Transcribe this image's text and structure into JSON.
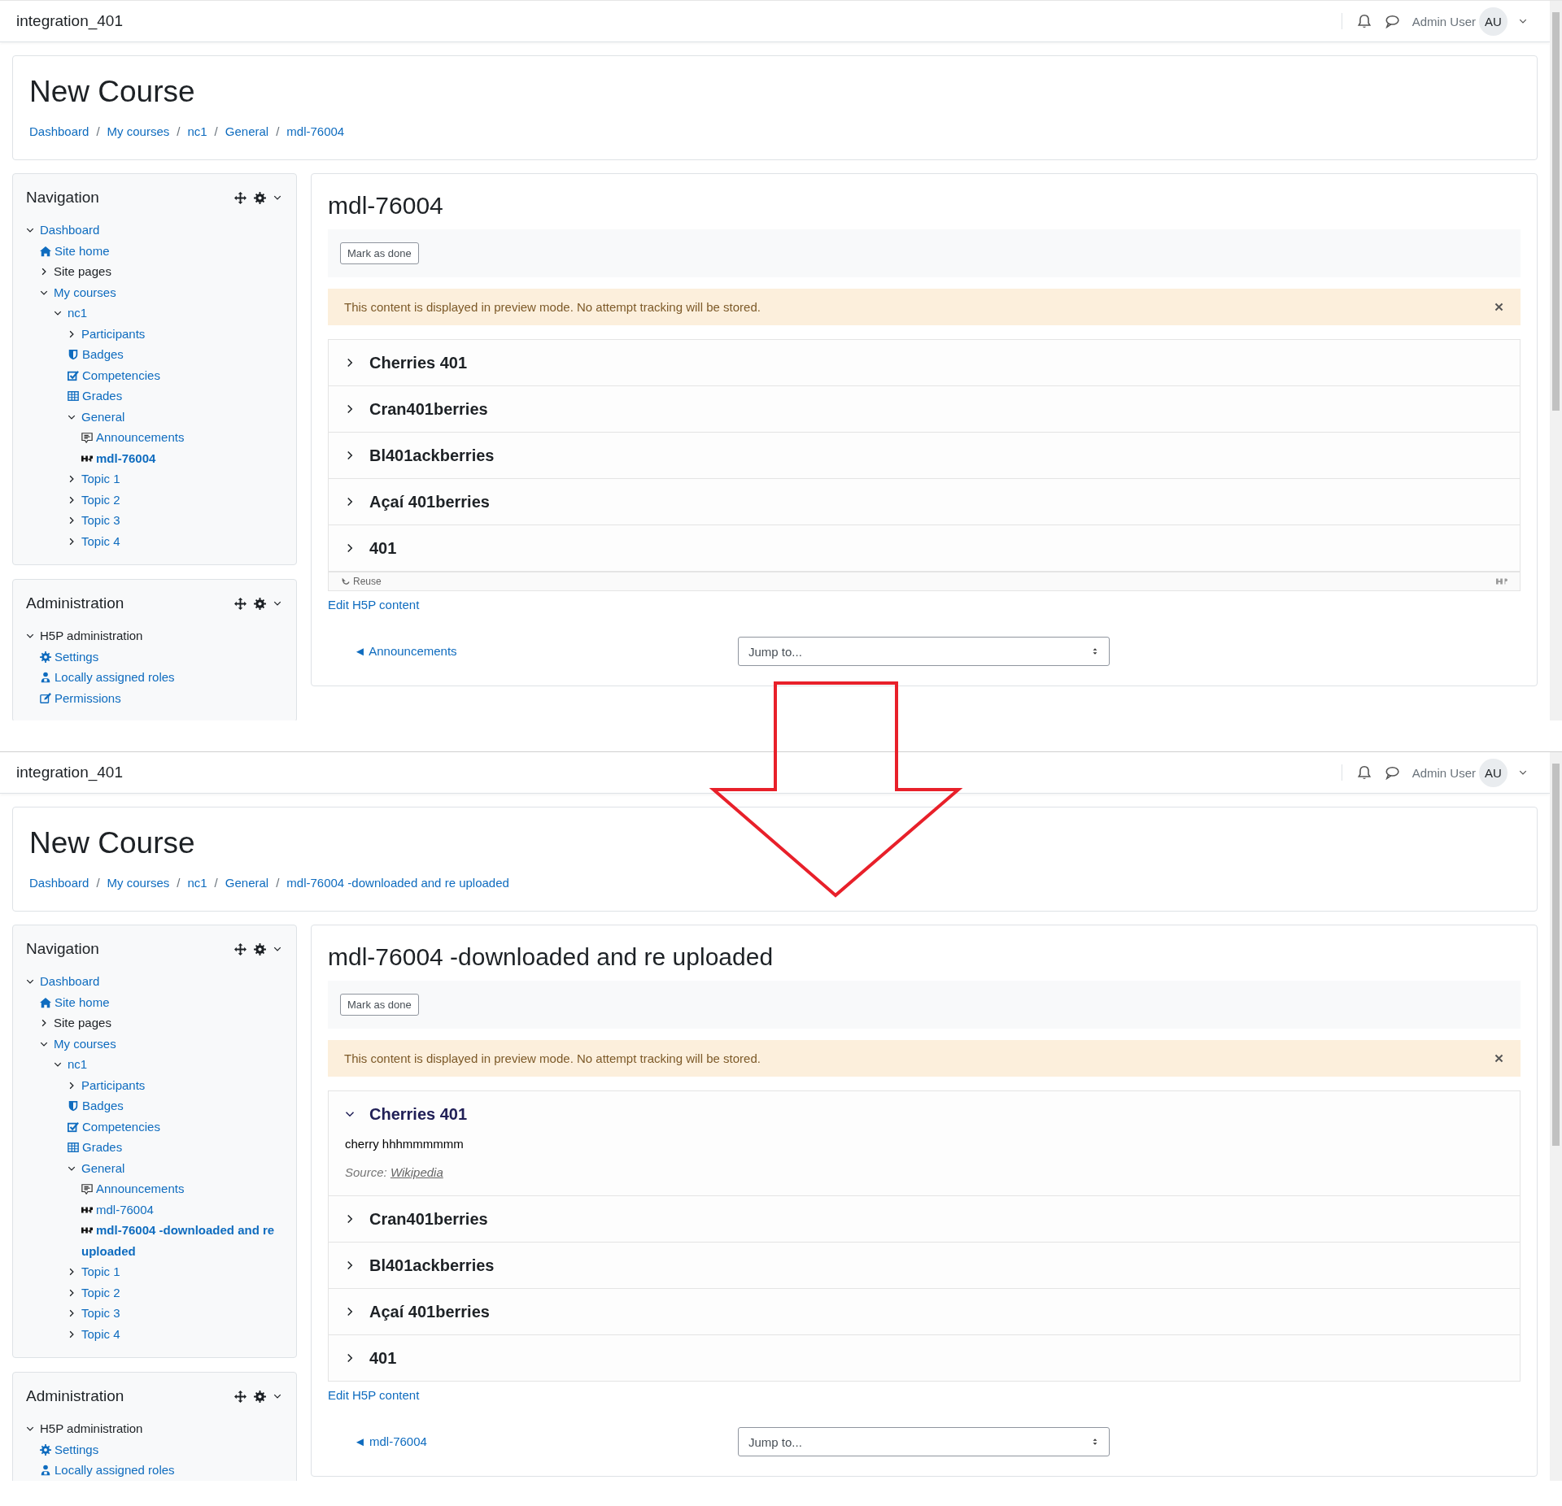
{
  "screens": [
    {
      "navbar": {
        "site_name": "integration_401",
        "user_name": "Admin User",
        "avatar": "AU"
      },
      "header": {
        "title": "New Course",
        "separator": "/",
        "breadcrumb": [
          "Dashboard",
          "My courses",
          "nc1",
          "General",
          "mdl-76004"
        ]
      },
      "blocks": [
        {
          "title": "Navigation",
          "tree": [
            {
              "label": "Dashboard",
              "kind": "branch",
              "link": true,
              "selected": false,
              "expanded": true,
              "children": [
                {
                  "label": "Site home",
                  "kind": "home",
                  "link": true,
                  "selected": false
                },
                {
                  "label": "Site pages",
                  "kind": "branch",
                  "link": false,
                  "selected": false,
                  "expanded": false
                },
                {
                  "label": "My courses",
                  "kind": "branch",
                  "link": true,
                  "selected": false,
                  "expanded": true,
                  "children": [
                    {
                      "label": "nc1",
                      "kind": "branch",
                      "link": true,
                      "selected": false,
                      "expanded": true,
                      "children": [
                        {
                          "label": "Participants",
                          "kind": "branch",
                          "link": true,
                          "selected": false,
                          "expanded": false
                        },
                        {
                          "label": "Badges",
                          "kind": "badge",
                          "link": true,
                          "selected": false
                        },
                        {
                          "label": "Competencies",
                          "kind": "competency",
                          "link": true,
                          "selected": false
                        },
                        {
                          "label": "Grades",
                          "kind": "grades",
                          "link": true,
                          "selected": false
                        },
                        {
                          "label": "General",
                          "kind": "branch",
                          "link": true,
                          "selected": false,
                          "expanded": true,
                          "children": [
                            {
                              "label": "Announcements",
                              "kind": "forum",
                              "link": true,
                              "selected": false
                            },
                            {
                              "label": "mdl-76004",
                              "kind": "h5p",
                              "link": true,
                              "selected": true
                            }
                          ]
                        },
                        {
                          "label": "Topic 1",
                          "kind": "branch",
                          "link": true,
                          "selected": false,
                          "expanded": false
                        },
                        {
                          "label": "Topic 2",
                          "kind": "branch",
                          "link": true,
                          "selected": false,
                          "expanded": false
                        },
                        {
                          "label": "Topic 3",
                          "kind": "branch",
                          "link": true,
                          "selected": false,
                          "expanded": false
                        },
                        {
                          "label": "Topic 4",
                          "kind": "branch",
                          "link": true,
                          "selected": false,
                          "expanded": false
                        }
                      ]
                    }
                  ]
                }
              ]
            }
          ]
        },
        {
          "title": "Administration",
          "tree": [
            {
              "label": "H5P administration",
              "kind": "branch",
              "link": false,
              "selected": false,
              "expanded": true,
              "children": [
                {
                  "label": "Settings",
                  "kind": "settings",
                  "link": true,
                  "selected": false
                },
                {
                  "label": "Locally assigned roles",
                  "kind": "roles",
                  "link": true,
                  "selected": false
                },
                {
                  "label": "Permissions",
                  "kind": "permissions",
                  "link": true,
                  "selected": false
                }
              ]
            }
          ]
        }
      ],
      "main": {
        "title": "mdl-76004",
        "mark_done": "Mark as done",
        "alert": "This content is displayed in preview mode. No attempt tracking will be stored.",
        "accordion": [
          {
            "title": "Cherries 401",
            "expanded": false
          },
          {
            "title": "Cran401berries",
            "expanded": false
          },
          {
            "title": "Bl401ackberries",
            "expanded": false
          },
          {
            "title": "Açaí 401berries",
            "expanded": false
          },
          {
            "title": "401",
            "expanded": false
          }
        ],
        "footer": {
          "reuse": "Reuse"
        },
        "edit_link": "Edit H5P content",
        "prev_link": "◄ Announcements",
        "jump": "Jump to..."
      }
    },
    {
      "navbar": {
        "site_name": "integration_401",
        "user_name": "Admin User",
        "avatar": "AU"
      },
      "header": {
        "title": "New Course",
        "separator": "/",
        "breadcrumb": [
          "Dashboard",
          "My courses",
          "nc1",
          "General",
          "mdl-76004 -downloaded and re uploaded"
        ]
      },
      "blocks": [
        {
          "title": "Navigation",
          "tree": [
            {
              "label": "Dashboard",
              "kind": "branch",
              "link": true,
              "selected": false,
              "expanded": true,
              "children": [
                {
                  "label": "Site home",
                  "kind": "home",
                  "link": true,
                  "selected": false
                },
                {
                  "label": "Site pages",
                  "kind": "branch",
                  "link": false,
                  "selected": false,
                  "expanded": false
                },
                {
                  "label": "My courses",
                  "kind": "branch",
                  "link": true,
                  "selected": false,
                  "expanded": true,
                  "children": [
                    {
                      "label": "nc1",
                      "kind": "branch",
                      "link": true,
                      "selected": false,
                      "expanded": true,
                      "children": [
                        {
                          "label": "Participants",
                          "kind": "branch",
                          "link": true,
                          "selected": false,
                          "expanded": false
                        },
                        {
                          "label": "Badges",
                          "kind": "badge",
                          "link": true,
                          "selected": false
                        },
                        {
                          "label": "Competencies",
                          "kind": "competency",
                          "link": true,
                          "selected": false
                        },
                        {
                          "label": "Grades",
                          "kind": "grades",
                          "link": true,
                          "selected": false
                        },
                        {
                          "label": "General",
                          "kind": "branch",
                          "link": true,
                          "selected": false,
                          "expanded": true,
                          "children": [
                            {
                              "label": "Announcements",
                              "kind": "forum",
                              "link": true,
                              "selected": false
                            },
                            {
                              "label": "mdl-76004",
                              "kind": "h5p",
                              "link": true,
                              "selected": false
                            },
                            {
                              "label": "mdl-76004 -downloaded and re uploaded",
                              "kind": "h5p",
                              "link": true,
                              "selected": true
                            }
                          ]
                        },
                        {
                          "label": "Topic 1",
                          "kind": "branch",
                          "link": true,
                          "selected": false,
                          "expanded": false
                        },
                        {
                          "label": "Topic 2",
                          "kind": "branch",
                          "link": true,
                          "selected": false,
                          "expanded": false
                        },
                        {
                          "label": "Topic 3",
                          "kind": "branch",
                          "link": true,
                          "selected": false,
                          "expanded": false
                        },
                        {
                          "label": "Topic 4",
                          "kind": "branch",
                          "link": true,
                          "selected": false,
                          "expanded": false
                        }
                      ]
                    }
                  ]
                }
              ]
            }
          ]
        },
        {
          "title": "Administration",
          "tree": [
            {
              "label": "H5P administration",
              "kind": "branch",
              "link": false,
              "selected": false,
              "expanded": true,
              "children": [
                {
                  "label": "Settings",
                  "kind": "settings",
                  "link": true,
                  "selected": false
                },
                {
                  "label": "Locally assigned roles",
                  "kind": "roles",
                  "link": true,
                  "selected": false
                }
              ]
            }
          ]
        }
      ],
      "main": {
        "title": "mdl-76004 -downloaded and re uploaded",
        "mark_done": "Mark as done",
        "alert": "This content is displayed in preview mode. No attempt tracking will be stored.",
        "accordion": [
          {
            "title": "Cherries 401",
            "expanded": true,
            "body": "cherry hhhmmmmmm",
            "source_label": "Source:",
            "source_link": "Wikipedia"
          },
          {
            "title": "Cran401berries",
            "expanded": false
          },
          {
            "title": "Bl401ackberries",
            "expanded": false
          },
          {
            "title": "Açaí 401berries",
            "expanded": false
          },
          {
            "title": "401",
            "expanded": false
          }
        ],
        "edit_link": "Edit H5P content",
        "prev_link": "◄ mdl-76004",
        "jump": "Jump to..."
      }
    }
  ]
}
